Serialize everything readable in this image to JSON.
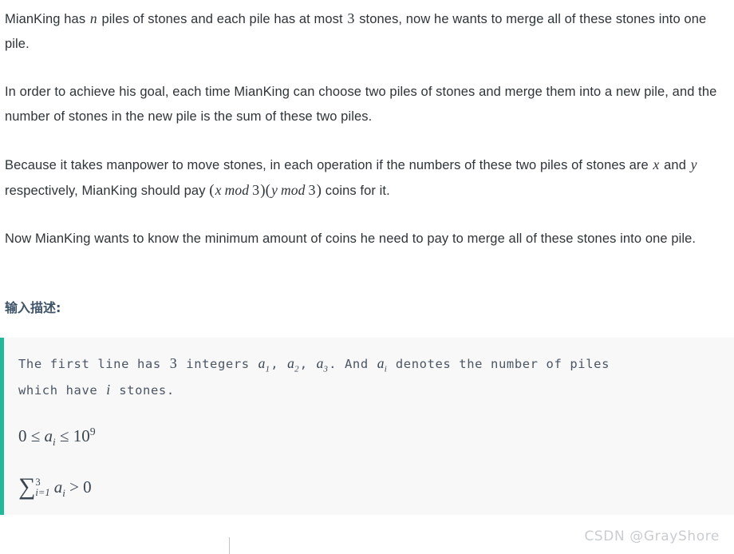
{
  "document": {
    "paragraphs": [
      {
        "id": "p1",
        "segments": [
          {
            "type": "text",
            "value": "MianKing has "
          },
          {
            "type": "math-italic",
            "value": "n"
          },
          {
            "type": "text",
            "value": " piles of stones and each pile has at most "
          },
          {
            "type": "math-number",
            "value": "3"
          },
          {
            "type": "text",
            "value": " stones, now he wants to merge all of these stones into one pile."
          }
        ],
        "plain": "MianKing has n piles of stones and each pile has at most 3 stones, now he wants to merge all of these stones into one pile."
      },
      {
        "id": "p2",
        "segments": [
          {
            "type": "text",
            "value": "In order to achieve his goal, each time MianKing can choose two piles of stones and merge them into a new pile, and the number of stones in the new pile is the sum of these two piles."
          }
        ],
        "plain": "In order to achieve his goal, each time MianKing can choose two piles of stones and merge them into a new pile, and the number of stones in the new pile is the sum of these two piles."
      },
      {
        "id": "p3",
        "segments": [
          {
            "type": "text",
            "value": "Because it takes manpower to move stones, in each operation if the numbers of these two piles of stones are "
          },
          {
            "type": "math-italic",
            "value": "x"
          },
          {
            "type": "text",
            "value": " and "
          },
          {
            "type": "math-italic",
            "value": "y"
          },
          {
            "type": "text",
            "value": " respectively, MianKing should pay "
          },
          {
            "type": "math-expr",
            "value": "(x mod 3)(y mod 3)"
          },
          {
            "type": "text",
            "value": " coins for it."
          }
        ],
        "plain": "Because it takes manpower to move stones, in each operation if the numbers of these two piles of stones are x and y respectively, MianKing should pay (x mod 3)(y mod 3) coins for it."
      },
      {
        "id": "p4",
        "segments": [
          {
            "type": "text",
            "value": "Now MianKing wants to know the minimum amount of coins he need to pay to merge all of these stones into one pile."
          }
        ],
        "plain": "Now MianKing wants to know the minimum amount of coins he need to pay to merge all of these stones into one pile."
      }
    ],
    "p1_prefix": "MianKing has",
    "p1_var_n": "n",
    "p1_mid": "piles of stones and each pile has at most",
    "p1_num3": "3",
    "p1_suffix": "stones, now he wants to merge all of these stones into one pile.",
    "p2_text": "In order to achieve his goal, each time MianKing can choose two piles of stones and merge them into a new pile, and the number of stones in the new pile is the sum of these two piles.",
    "p3_prefix": "Because it takes manpower to move stones, in each operation if the numbers of these two piles of stones are",
    "p3_var_x": "x",
    "p3_and": "and",
    "p3_var_y": "y",
    "p3_mid": "respectively, MianKing should pay",
    "p3_expr_open": "(",
    "p3_expr_x": "x",
    "p3_expr_mod1": "mod",
    "p3_expr_3a": "3",
    "p3_expr_close1": ")(",
    "p3_expr_y": "y",
    "p3_expr_mod2": "mod",
    "p3_expr_3b": "3",
    "p3_expr_close2": ")",
    "p3_suffix": "coins for it.",
    "p4_text": "Now MianKing wants to know the minimum amount of coins he need to pay to merge all of these stones into one pile.",
    "input_section": {
      "heading": "输入描述:",
      "heading_color": "#3f5469",
      "accent_color": "#22b99a",
      "background_color": "#f8f8f8",
      "code_line_1_part1": "The first line has ",
      "code_line_1_num": "3",
      "code_line_1_part2": " integers ",
      "code_line_1_a": "a",
      "code_line_1_sub1": "1",
      "code_line_1_comma1": ", ",
      "code_line_1_a2": "a",
      "code_line_1_sub2": "2",
      "code_line_1_comma2": ", ",
      "code_line_1_a3": "a",
      "code_line_1_sub3": "3",
      "code_line_1_part3": ". And ",
      "code_line_1_ai": "a",
      "code_line_1_subi": "i",
      "code_line_1_part4": " denotes the number of piles",
      "code_line_2_part1": "which have ",
      "code_line_2_i": "i",
      "code_line_2_part2": " stones.",
      "formula_1": {
        "zero": "0",
        "le1": "≤",
        "a": "a",
        "sub": "i",
        "le2": "≤",
        "ten": "10",
        "power": "9",
        "plain": "0 ≤ a_i ≤ 10^9"
      },
      "formula_2": {
        "sigma": "∑",
        "upper": "3",
        "lower": "i=1",
        "a": "a",
        "sub": "i",
        "gt": ">",
        "zero": "0",
        "plain": "∑_{i=1}^{3} a_i > 0"
      }
    }
  },
  "watermark": {
    "text": "CSDN @GrayShore",
    "color": "#c9ccd0"
  }
}
